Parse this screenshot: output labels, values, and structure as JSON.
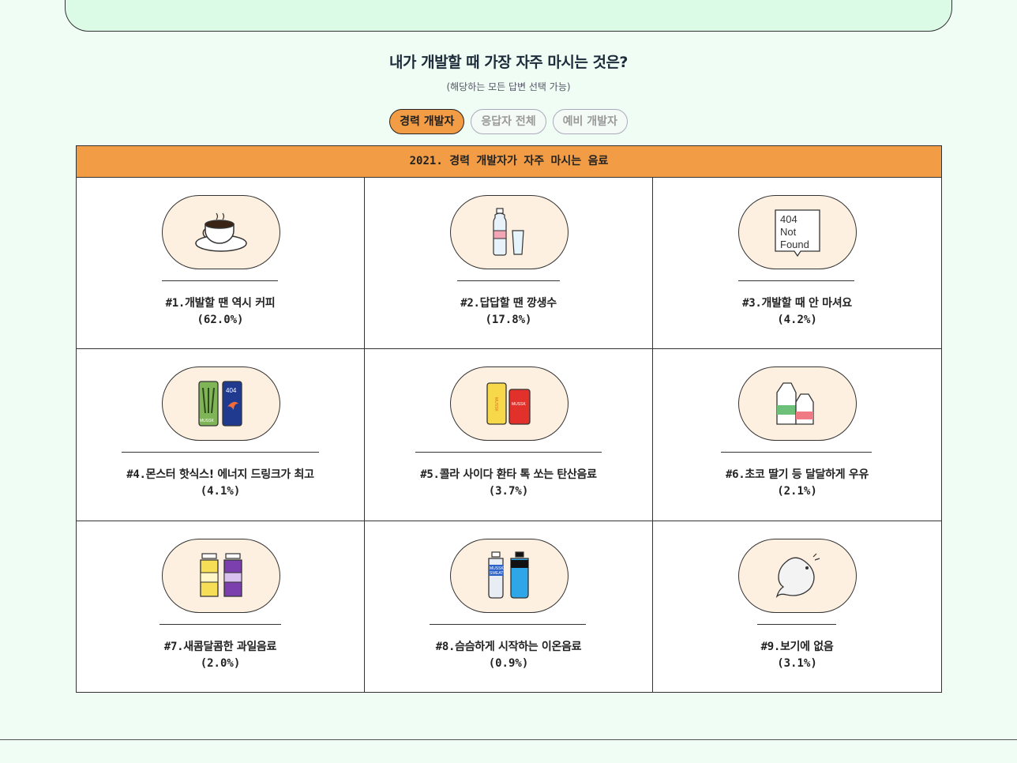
{
  "question": "내가 개발할 때 가장 자주 마시는 것은?",
  "subtitle": "(해당하는 모든 답변 선택 가능)",
  "tabs": [
    {
      "label": "경력 개발자",
      "active": true
    },
    {
      "label": "응답자 전체",
      "active": false
    },
    {
      "label": "예비 개발자",
      "active": false
    }
  ],
  "table_title": "2021. 경력 개발자가 자주 마시는 음료",
  "items": [
    {
      "rank": "#1.",
      "label": "개발할 땐 역시 커피",
      "pct": "(62.0%)",
      "icon": "coffee-cup-icon"
    },
    {
      "rank": "#2.",
      "label": "답답할 땐 깡생수",
      "pct": "(17.8%)",
      "icon": "water-bottle-icon"
    },
    {
      "rank": "#3.",
      "label": "개발할 때 안 마셔요",
      "pct": "(4.2%)",
      "icon": "not-found-icon",
      "icon_text": [
        "404",
        "Not",
        "Found"
      ]
    },
    {
      "rank": "#4.",
      "label": "몬스터 핫식스! 에너지 드링크가 최고",
      "pct": "(4.1%)",
      "icon": "energy-drink-icon",
      "icon_text": [
        "404",
        "MUSSK"
      ]
    },
    {
      "rank": "#5.",
      "label": "콜라 사이다 환타 톡 쏘는 탄산음료",
      "pct": "(3.7%)",
      "icon": "soda-can-icon",
      "icon_text": [
        "MUSSK",
        "MUSSK"
      ]
    },
    {
      "rank": "#6.",
      "label": "초코 딸기 등 달달하게 우유",
      "pct": "(2.1%)",
      "icon": "milk-carton-icon"
    },
    {
      "rank": "#7.",
      "label": "새콤달콤한 과일음료",
      "pct": "(2.0%)",
      "icon": "juice-bottle-icon"
    },
    {
      "rank": "#8.",
      "label": "슴슴하게 시작하는 이온음료",
      "pct": "(0.9%)",
      "icon": "sports-drink-icon",
      "icon_text": [
        "MUSSK",
        "SWEAT"
      ]
    },
    {
      "rank": "#9.",
      "label": "보기에 없음",
      "pct": "(3.1%)",
      "icon": "ghost-icon"
    }
  ],
  "colors": {
    "accent": "#f29d46",
    "background": "#effdf4",
    "pill": "#fdf0e0"
  }
}
